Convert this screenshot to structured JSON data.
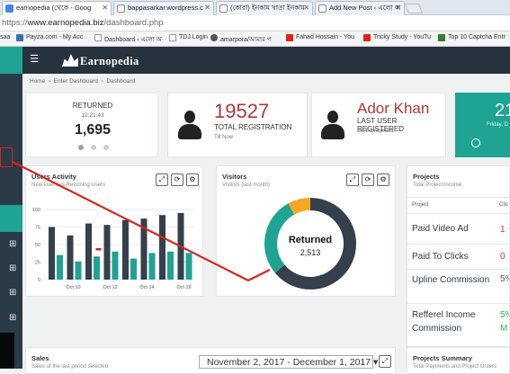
{
  "browser": {
    "tabs": [
      {
        "label": "earnopedia (থেকে - Goog",
        "favicon_color": "#4285f4"
      },
      {
        "label": "bappasarkar.wordpress.c",
        "favicon_color": "#6b6b6b"
      },
      {
        "label": "(কোরা) ইনকাম খাতা ইনকাম",
        "favicon_color": "#7d7d7d"
      },
      {
        "label": "Add New Post ‹ এলো অ",
        "favicon_color": "#7d7d7d"
      }
    ],
    "url_scheme": "https://",
    "url_host": "www.earnopedia.biz",
    "url_path": "/dashboard.php",
    "bookmarks": [
      {
        "label": "saa",
        "color": "#888888"
      },
      {
        "label": "Payza.com - My Acc",
        "color": "#3b6fb6"
      },
      {
        "label": "Dashboard ‹ এলো অ",
        "color": "#999999"
      },
      {
        "label": "TDJ Login",
        "color": "#999999"
      },
      {
        "label": "amarpora/আমার প",
        "color": "#555555"
      },
      {
        "label": "Fahad Hossain - You",
        "color": "#e62117"
      },
      {
        "label": "Tricky Study - YouTu",
        "color": "#e62117"
      },
      {
        "label": "Top 10 Captcha Entr",
        "color": "#2e7d32"
      }
    ]
  },
  "header": {
    "menu_icon": "hamburger-icon",
    "logo_text": "Earnopedia"
  },
  "breadcrumb": {
    "home": "Home",
    "sep1": "›",
    "middle": "Enter Dashboard",
    "sep2": "›",
    "current": "Dashboard"
  },
  "stats": {
    "returned": {
      "title": "RETURNED",
      "time": "12:21:43",
      "value": "1,695"
    },
    "registration": {
      "value": "19527",
      "label": "TOTAL REGISTRATION",
      "sub": "Till Now"
    },
    "last_user": {
      "name": "Ador Khan",
      "label": "LAST USER REGISTERED",
      "sub": "On Earnopedia"
    },
    "clock": {
      "value": "21",
      "sub": "Friday, D"
    }
  },
  "users_activity": {
    "title": "Users Activity",
    "subtitle": "New Users vs Returning Users"
  },
  "visitors": {
    "title": "Visitors",
    "subtitle": "Visitors (last month)",
    "donut_label": "Returned",
    "donut_value": "2,513"
  },
  "projects": {
    "title": "Projects",
    "subtitle": "Total Project Income",
    "col_project": "Project",
    "col_clicks": "Clic",
    "rows": [
      {
        "name": "Paid Video Ad",
        "value": "1",
        "color": "#c0392b"
      },
      {
        "name": "Paid To Clicks",
        "value": "0",
        "color": "#c0392b"
      },
      {
        "name": "Upline Commission",
        "value": "5%",
        "color": "#555555"
      },
      {
        "name": "Refferel Income Commission",
        "value": "5% M",
        "color": "#27ae60"
      }
    ]
  },
  "sales": {
    "title": "Sales",
    "subtitle": "Sales of the last period selected"
  },
  "date_range": "November 2, 2017 - December 1, 2017",
  "projects_summary": {
    "title": "Projects Summary",
    "subtitle": "Total Payments and Project Orders"
  },
  "colors": {
    "teal": "#1fa392",
    "dark": "#34404c",
    "orange": "#f5a623",
    "accent_red": "#b03838"
  },
  "chart_data": [
    {
      "type": "bar",
      "categories": [
        "",
        "Oct 10",
        "",
        "Oct 12",
        "",
        "Oct 14",
        "",
        "Oct 16"
      ],
      "x_tick_labels": [
        "Oct 10",
        "Oct 12",
        "Oct 14",
        "Oct 16"
      ],
      "series": [
        {
          "values": [
            75,
            63,
            80,
            78,
            85,
            87,
            92,
            95
          ],
          "color": "#34404c"
        },
        {
          "values": [
            35,
            26,
            33,
            40,
            30,
            38,
            40,
            38
          ],
          "color": "#1fa392"
        }
      ],
      "y_ticks": [
        0,
        25,
        50,
        75,
        100
      ],
      "ylim": [
        0,
        100
      ],
      "grid": true
    },
    {
      "type": "pie",
      "style": "donut",
      "center_label": "Returned",
      "center_value": "2,513",
      "slices": [
        {
          "value": 64,
          "color": "#34404c"
        },
        {
          "value": 28,
          "color": "#1fa392"
        },
        {
          "value": 8,
          "color": "#f5a623"
        }
      ]
    }
  ]
}
